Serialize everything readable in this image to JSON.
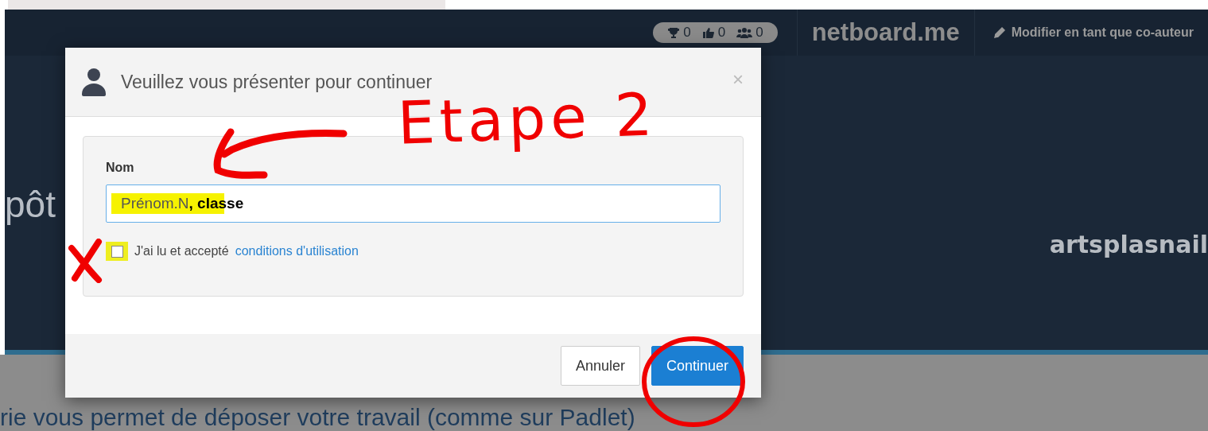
{
  "top_bar": {
    "stats": [
      {
        "kind": "trophy",
        "count": "0"
      },
      {
        "kind": "likes",
        "count": "0"
      },
      {
        "kind": "members",
        "count": "0"
      }
    ],
    "brand": "netboard.me",
    "edit_link": "Modifier en tant que co-auteur"
  },
  "background": {
    "heading": "pôt",
    "author": "artsplasnail",
    "description": "rie vous permet de déposer votre travail (comme sur Padlet)"
  },
  "dialog": {
    "title": "Veuillez vous présenter pour continuer",
    "close": "×",
    "field_label": "Nom",
    "name_value": "Prénom.N**, classe**",
    "terms": {
      "checked": false,
      "text": "J'ai lu et accepté",
      "link": "conditions d'utilisation"
    },
    "buttons": [
      {
        "kind": "secondary",
        "label": "Annuler"
      },
      {
        "kind": "primary",
        "label": "Continuer"
      }
    ]
  },
  "annotation": {
    "label": "Etape 2"
  }
}
